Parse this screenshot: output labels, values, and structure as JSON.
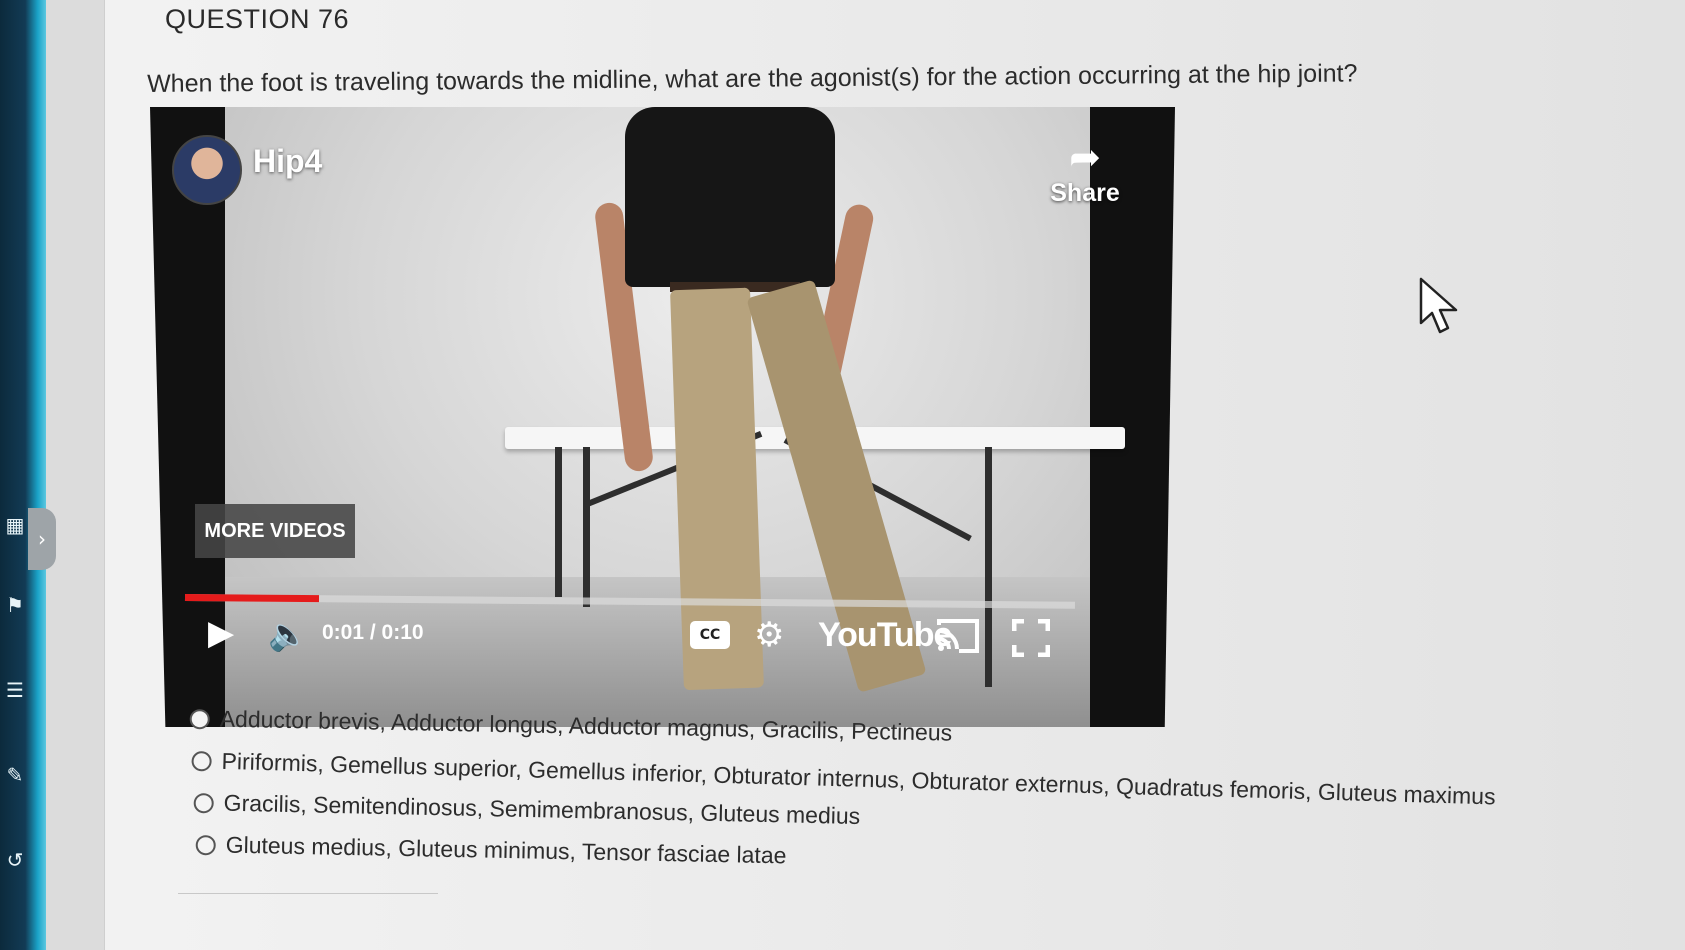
{
  "question": {
    "number_label": "QUESTION 76",
    "prompt": "When the foot is traveling towards the midline, what are the agonist(s) for the action occurring at the hip joint?"
  },
  "video": {
    "title": "Hip4",
    "share_label": "Share",
    "more_videos_label": "MORE VIDEOS",
    "time_display": "0:01 / 0:10",
    "progress_fraction": 0.15,
    "cc_label": "CC",
    "brand": "YouTube",
    "accent_color": "#e51b1b"
  },
  "answers": [
    {
      "label": "Adductor brevis, Adductor longus, Adductor magnus, Gracilis, Pectineus",
      "selected": false
    },
    {
      "label": "Piriformis, Gemellus superior, Gemellus inferior, Obturator internus, Obturator externus, Quadratus femoris, Gluteus maximus",
      "selected": false
    },
    {
      "label": "Gracilis, Semitendinosus, Semimembranosus, Gluteus medius",
      "selected": false
    },
    {
      "label": "Gluteus medius, Gluteus minimus, Tensor fasciae latae",
      "selected": false
    }
  ],
  "icons": {
    "sidebar_toggle": "chevron-right-icon",
    "play": "play-icon",
    "volume": "volume-icon",
    "settings": "gear-icon",
    "cast": "cast-icon",
    "fullscreen": "fullscreen-icon",
    "share": "share-arrow-icon",
    "pointer": "mouse-pointer-icon"
  }
}
